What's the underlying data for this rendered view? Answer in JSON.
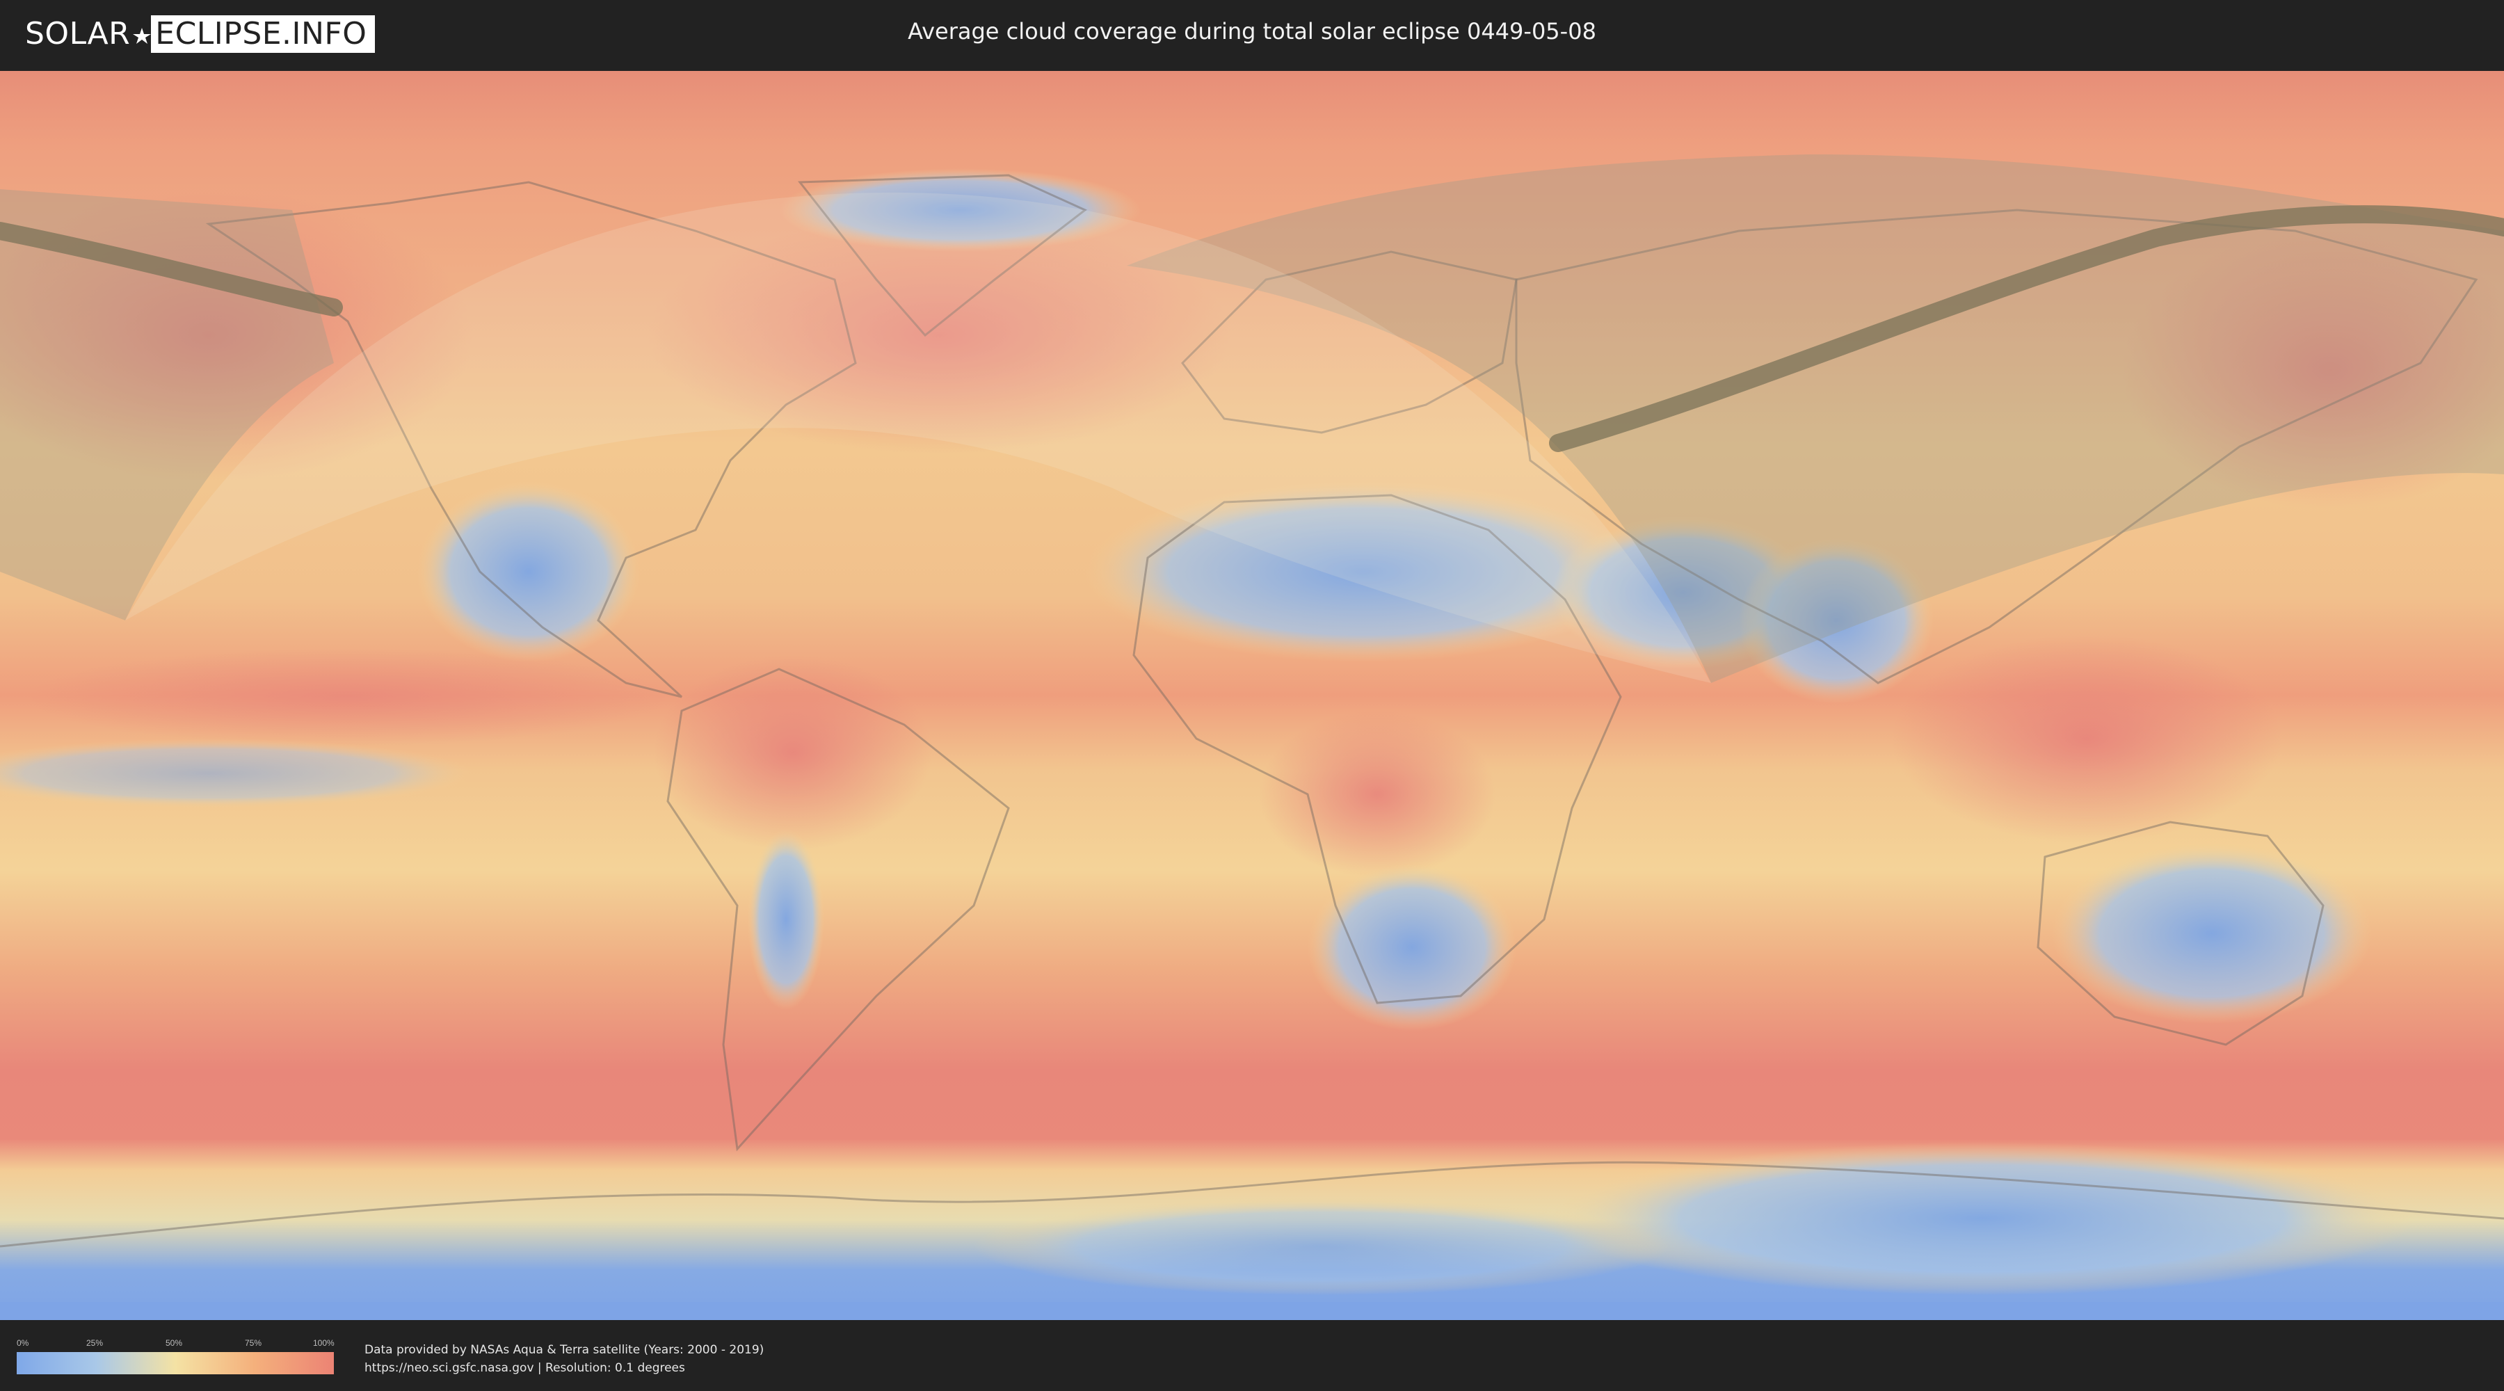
{
  "header": {
    "logo_left": "SOLAR",
    "logo_right": "ECLIPSE.INFO",
    "title": "Average cloud coverage during total solar eclipse 0449-05-08"
  },
  "legend": {
    "ticks": [
      "0%",
      "25%",
      "50%",
      "75%",
      "100%"
    ],
    "tick_fractions": [
      0,
      0.25,
      0.5,
      0.75,
      1.0
    ],
    "gradient_colors": [
      "#7fa8e8",
      "#a9c8e8",
      "#f4e2a4",
      "#f4b07c",
      "#ec8374"
    ]
  },
  "credits": {
    "line1": "Data provided by NASAs Aqua & Terra satellite (Years: 2000 - 2019)",
    "line2": "https://neo.sci.gsfc.nasa.gov | Resolution: 0.1 degrees"
  },
  "map": {
    "projection": "equirectangular",
    "layer": "average cloud coverage",
    "eclipse_type": "total",
    "ocean_color": "#f2bf8e",
    "cloudy_color": "#ea8676",
    "clear_color": "#7fa6e4",
    "path_color": "#8a8262",
    "shadow_color": "#9a9a8a"
  }
}
